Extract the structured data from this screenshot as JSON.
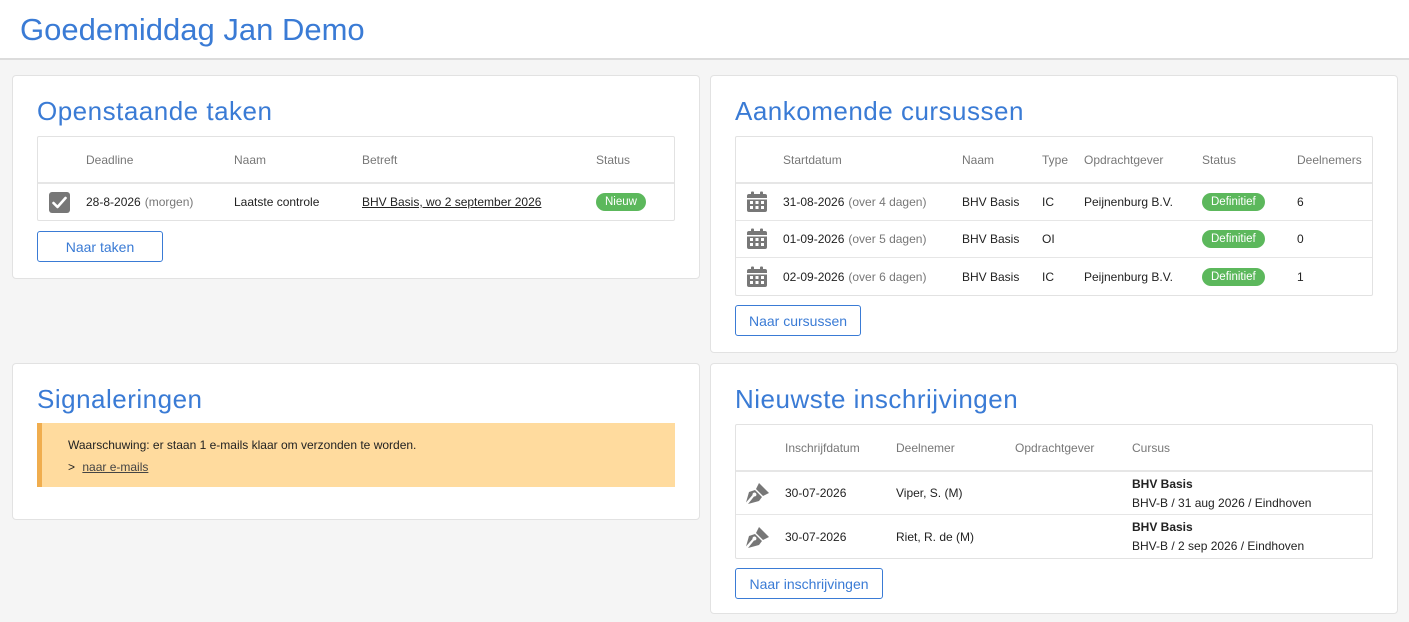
{
  "header": {
    "greeting": "Goedemiddag Jan Demo"
  },
  "tasks": {
    "title": "Openstaande taken",
    "columns": [
      "Deadline",
      "Naam",
      "Betreft",
      "Status"
    ],
    "rows": [
      {
        "deadline": "28-8-2026",
        "relative": "(morgen)",
        "name": "Laatste controle",
        "subject": "BHV Basis, wo 2 september 2026",
        "status": "Nieuw"
      }
    ],
    "button": "Naar taken"
  },
  "courses": {
    "title": "Aankomende cursussen",
    "columns": [
      "Startdatum",
      "Naam",
      "Type",
      "Opdrachtgever",
      "Status",
      "Deelnemers"
    ],
    "rows": [
      {
        "date": "31-08-2026",
        "relative": "(over 4 dagen)",
        "name": "BHV Basis",
        "type": "IC",
        "client": "Peijnenburg B.V.",
        "status": "Definitief",
        "participants": "6"
      },
      {
        "date": "01-09-2026",
        "relative": "(over 5 dagen)",
        "name": "BHV Basis",
        "type": "OI",
        "client": "",
        "status": "Definitief",
        "participants": "0"
      },
      {
        "date": "02-09-2026",
        "relative": "(over 6 dagen)",
        "name": "BHV Basis",
        "type": "IC",
        "client": "Peijnenburg B.V.",
        "status": "Definitief",
        "participants": "1"
      }
    ],
    "button": "Naar cursussen"
  },
  "signals": {
    "title": "Signaleringen",
    "warning": "Waarschuwing: er staan 1 e-mails klaar om verzonden te worden.",
    "prefix": ">",
    "link": "naar e-mails"
  },
  "registrations": {
    "title": "Nieuwste inschrijvingen",
    "columns": [
      "Inschrijfdatum",
      "Deelnemer",
      "Opdrachtgever",
      "Cursus"
    ],
    "rows": [
      {
        "date": "30-07-2026",
        "participant": "Viper, S. (M)",
        "client": "",
        "course": "BHV Basis",
        "course_detail": "BHV-B / 31 aug 2026 / Eindhoven"
      },
      {
        "date": "30-07-2026",
        "participant": "Riet, R. de (M)",
        "client": "",
        "course": "BHV Basis",
        "course_detail": "BHV-B / 2 sep 2026 / Eindhoven"
      }
    ],
    "button": "Naar inschrijvingen"
  }
}
